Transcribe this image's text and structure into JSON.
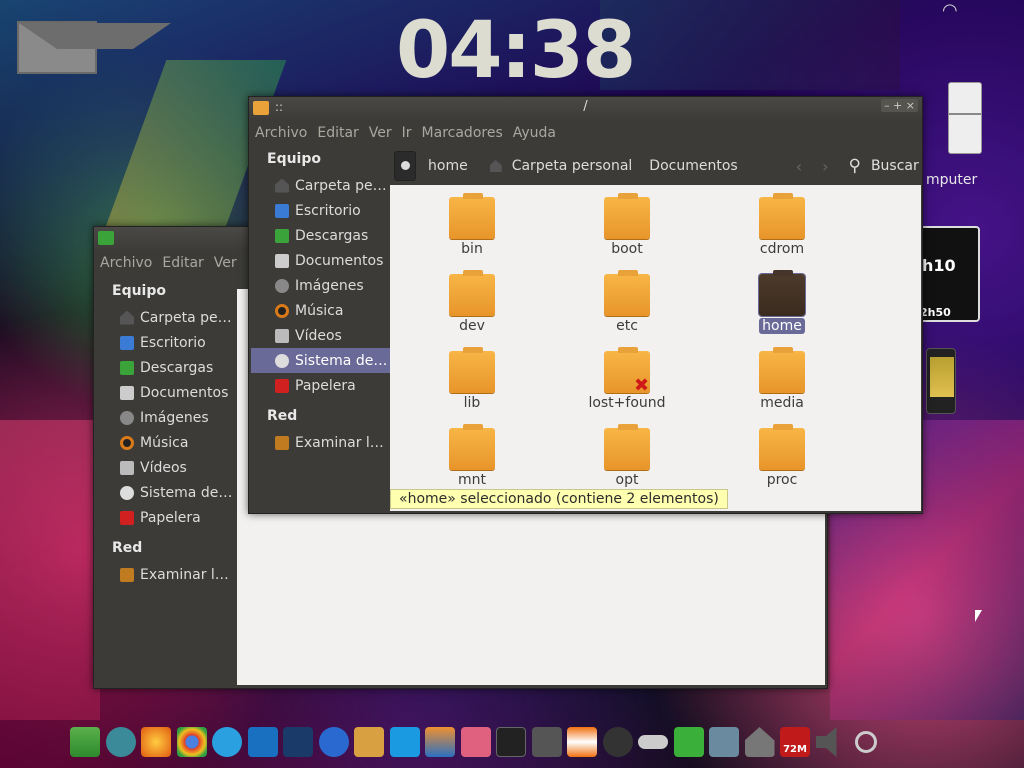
{
  "desktop": {
    "clock": "04:38",
    "computer_label": "mputer",
    "gauge_number": "h10",
    "gauge_sub": "2h50"
  },
  "front_window": {
    "title": "/",
    "title_dots": "::",
    "controls": "– + ×",
    "menu": [
      "Archivo",
      "Editar",
      "Ver",
      "Ir",
      "Marcadores",
      "Ayuda"
    ],
    "sidebar": {
      "heading_devices": "Equipo",
      "items": [
        {
          "label": "Carpeta pe…",
          "icon": "home-icon"
        },
        {
          "label": "Escritorio",
          "icon": "desktop-icon"
        },
        {
          "label": "Descargas",
          "icon": "downloads-icon"
        },
        {
          "label": "Documentos",
          "icon": "documents-icon"
        },
        {
          "label": "Imágenes",
          "icon": "images-icon"
        },
        {
          "label": "Música",
          "icon": "music-icon"
        },
        {
          "label": "Vídeos",
          "icon": "videos-icon"
        },
        {
          "label": "Sistema de…",
          "icon": "filesystem-icon"
        },
        {
          "label": "Papelera",
          "icon": "trash-icon"
        }
      ],
      "heading_network": "Red",
      "network_items": [
        {
          "label": "Examinar l…",
          "icon": "network-icon"
        }
      ]
    },
    "pathbar": {
      "crumbs": [
        "home",
        "Carpeta personal",
        "Documentos"
      ],
      "search_label": "Buscar"
    },
    "files": [
      {
        "name": "bin"
      },
      {
        "name": "boot"
      },
      {
        "name": "cdrom"
      },
      {
        "name": "dev"
      },
      {
        "name": "etc"
      },
      {
        "name": "home"
      },
      {
        "name": "lib"
      },
      {
        "name": "lost+found"
      },
      {
        "name": "media"
      },
      {
        "name": "mnt"
      },
      {
        "name": "opt"
      },
      {
        "name": "proc"
      }
    ],
    "status": "«home» seleccionado (contiene 2 elementos)"
  },
  "back_window": {
    "menu": [
      "Archivo",
      "Editar",
      "Ver"
    ],
    "sidebar": {
      "heading_devices": "Equipo",
      "items": [
        {
          "label": "Carpeta pe…"
        },
        {
          "label": "Escritorio"
        },
        {
          "label": "Descargas"
        },
        {
          "label": "Documentos"
        },
        {
          "label": "Imágenes"
        },
        {
          "label": "Música"
        },
        {
          "label": "Vídeos"
        },
        {
          "label": "Sistema de…"
        },
        {
          "label": "Papelera"
        }
      ],
      "heading_network": "Red",
      "network_items": [
        {
          "label": "Examinar l…"
        }
      ]
    }
  },
  "dock": {
    "memory_label": "72M",
    "apps": [
      "downloader",
      "chat",
      "firefox",
      "chrome",
      "skype",
      "messenger",
      "disk-usage",
      "pidgin",
      "download-manager",
      "twitter",
      "office",
      "pocket",
      "terminal",
      "calculator",
      "vlc",
      "speaker",
      "toggle",
      "download",
      "system-monitor",
      "home",
      "trash",
      "volume",
      "power"
    ]
  }
}
